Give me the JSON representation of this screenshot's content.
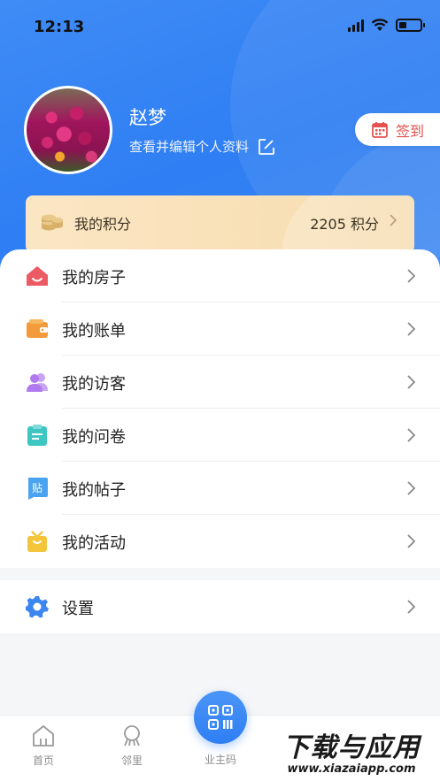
{
  "status_bar": {
    "time": "12:13"
  },
  "profile": {
    "name": "赵梦",
    "edit_text": "查看并编辑个人资料",
    "checkin_label": "签到"
  },
  "points": {
    "label": "我的积分",
    "value": "2205 积分"
  },
  "menu": {
    "items": [
      {
        "label": "我的房子",
        "icon": "house-icon",
        "color": "#ec5a63"
      },
      {
        "label": "我的账单",
        "icon": "wallet-icon",
        "color": "#f39a3b"
      },
      {
        "label": "我的访客",
        "icon": "visitors-icon",
        "color": "#b079ee"
      },
      {
        "label": "我的问卷",
        "icon": "clipboard-icon",
        "color": "#3ec6c2"
      },
      {
        "label": "我的帖子",
        "icon": "post-icon",
        "color": "#4aa3f0"
      },
      {
        "label": "我的活动",
        "icon": "gift-icon",
        "color": "#f4c43a"
      }
    ]
  },
  "settings": {
    "label": "设置",
    "icon": "gear-icon",
    "color": "#3c86f0"
  },
  "tabbar": {
    "home": "首页",
    "neighbors": "邻里",
    "owner_code": "业主码"
  },
  "watermark": {
    "title": "下载与应用",
    "url": "www.xiazaiapp.com"
  }
}
